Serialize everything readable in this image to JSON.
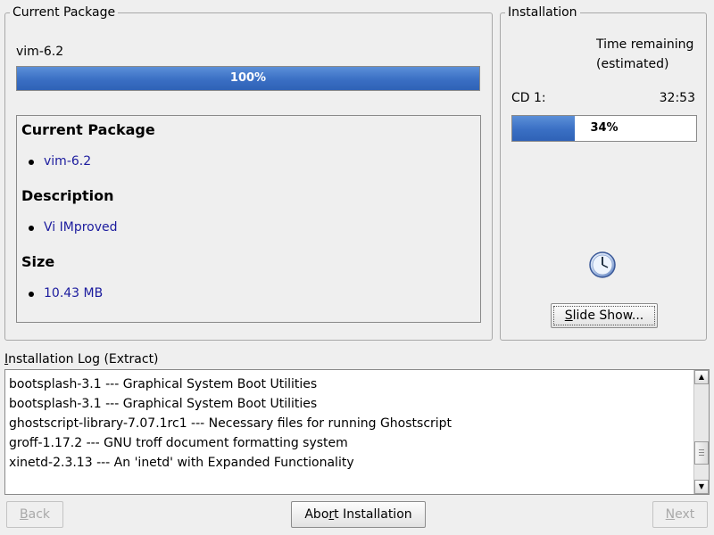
{
  "current_package": {
    "group_title": "Current Package",
    "package_name": "vim-6.2",
    "progress_percent": 100,
    "progress_text": "100%",
    "details": {
      "package_heading": "Current Package",
      "package_value": "vim-6.2",
      "description_heading": "Description",
      "description_value": "Vi IMproved",
      "size_heading": "Size",
      "size_value": "10.43 MB"
    }
  },
  "installation": {
    "group_title": "Installation",
    "time_remaining_line1": "Time remaining",
    "time_remaining_line2": "(estimated)",
    "cd_label": "CD 1:",
    "cd_time": "32:53",
    "cd_progress_percent": 34,
    "cd_progress_text": "34%",
    "clock_icon": "clock-icon",
    "slideshow_button": {
      "underlined": "S",
      "rest": "lide Show..."
    }
  },
  "log": {
    "label_underlined": "I",
    "label_rest": "nstallation Log (Extract)",
    "lines": [
      "bootsplash-3.1 --- Graphical System Boot Utilities",
      "bootsplash-3.1 --- Graphical System Boot Utilities",
      "ghostscript-library-7.07.1rc1 --- Necessary files for running Ghostscript",
      "groff-1.17.2 --- GNU troff document formatting system",
      "xinetd-2.3.13 --- An 'inetd' with Expanded Functionality"
    ]
  },
  "buttons": {
    "back": {
      "underlined": "B",
      "rest": "ack"
    },
    "abort": {
      "before": "Abo",
      "underlined": "r",
      "after": "t Installation"
    },
    "next": {
      "underlined": "N",
      "rest": "ext"
    }
  },
  "colors": {
    "progress_fill": "#3a6fc4",
    "info_text": "#1c1c9e",
    "background": "#efefef"
  }
}
